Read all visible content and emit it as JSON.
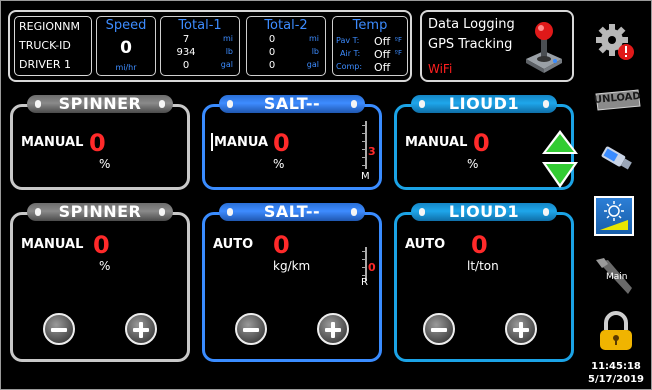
{
  "status": {
    "region": "REGIONNM",
    "truck": "TRUCK-ID",
    "driver": "DRIVER 1",
    "speed": {
      "title": "Speed",
      "value": "0",
      "unit": "mi/hr"
    },
    "total1": {
      "title": "Total-1",
      "rows": [
        {
          "v": "7",
          "u": "mi"
        },
        {
          "v": "934",
          "u": "lb"
        },
        {
          "v": "0",
          "u": "gal"
        }
      ]
    },
    "total2": {
      "title": "Total-2",
      "rows": [
        {
          "v": "0",
          "u": "mi"
        },
        {
          "v": "0",
          "u": "lb"
        },
        {
          "v": "0",
          "u": "gal"
        }
      ]
    },
    "temp": {
      "title": "Temp",
      "rows": [
        {
          "l": "Pav T:",
          "v": "Off",
          "u": "ºF"
        },
        {
          "l": "Air T:",
          "v": "Off",
          "u": "ºF"
        },
        {
          "l": "Comp:",
          "v": "Off",
          "u": ""
        }
      ]
    }
  },
  "logging": {
    "data_logging": "Data Logging",
    "gps": "GPS Tracking",
    "wifi": "WiFi"
  },
  "panels": [
    {
      "title": "SPINNER",
      "mode": "MANUAL",
      "value": "0",
      "unit": "%"
    },
    {
      "title": "SALT--",
      "mode": "MANUA",
      "value": "0",
      "unit": "%",
      "gauge_value": "3",
      "gauge_letter": "M"
    },
    {
      "title": "LIOUD1",
      "mode": "MANUAL",
      "value": "0",
      "unit": "%"
    },
    {
      "title": "SPINNER",
      "mode": "MANUAL",
      "value": "0",
      "unit": "%"
    },
    {
      "title": "SALT--",
      "mode": "AUTO",
      "value": "0",
      "unit": "kg/km",
      "gauge_value": "0",
      "gauge_letter": "R"
    },
    {
      "title": "LIOUD1",
      "mode": "AUTO",
      "value": "0",
      "unit": "lt/ton"
    }
  ],
  "toolbar": {
    "unload_label": "UNLOAD",
    "main_label": "Main"
  },
  "clock": {
    "time": "11:45:18",
    "date": "5/17/2019"
  },
  "colors": {
    "accent_blue": "#3a8cff",
    "accent_cyan": "#1ba3e6",
    "value_red": "#ff2a2a",
    "arrow_green": "#33cc33"
  }
}
